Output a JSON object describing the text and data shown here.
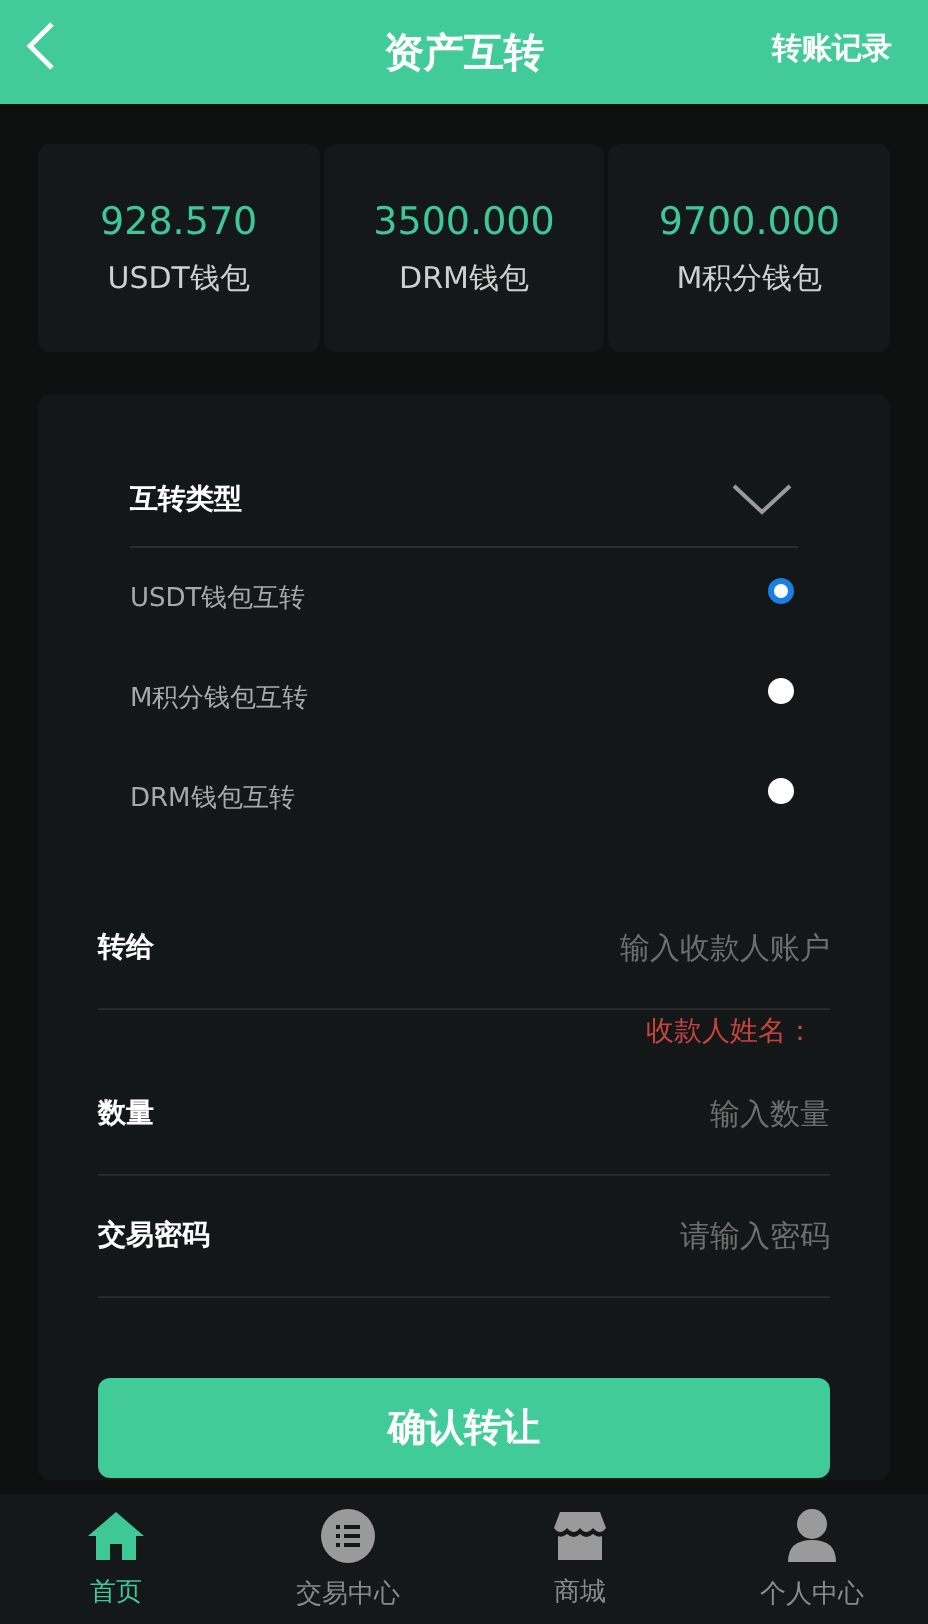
{
  "header": {
    "title": "资产互转",
    "action": "转账记录"
  },
  "wallets": [
    {
      "amount": "928.570",
      "label": "USDT钱包"
    },
    {
      "amount": "3500.000",
      "label": "DRM钱包"
    },
    {
      "amount": "9700.000",
      "label": "M积分钱包"
    }
  ],
  "transfer_type": {
    "label": "互转类型",
    "expanded": true,
    "options": [
      {
        "label": "USDT钱包互转",
        "selected": true
      },
      {
        "label": "M积分钱包互转",
        "selected": false
      },
      {
        "label": "DRM钱包互转",
        "selected": false
      }
    ]
  },
  "fields": [
    {
      "label": "转给",
      "placeholder": "输入收款人账户",
      "note": "收款人姓名："
    },
    {
      "label": "数量",
      "placeholder": "输入数量"
    },
    {
      "label": "交易密码",
      "placeholder": "请输入密码"
    }
  ],
  "submit": "确认转让",
  "tabbar": [
    {
      "label": "首页",
      "kind": "home",
      "selected": true
    },
    {
      "label": "交易中心",
      "kind": "list",
      "selected": false
    },
    {
      "label": "商城",
      "kind": "shop",
      "selected": false
    },
    {
      "label": "个人中心",
      "kind": "user",
      "selected": false
    }
  ]
}
